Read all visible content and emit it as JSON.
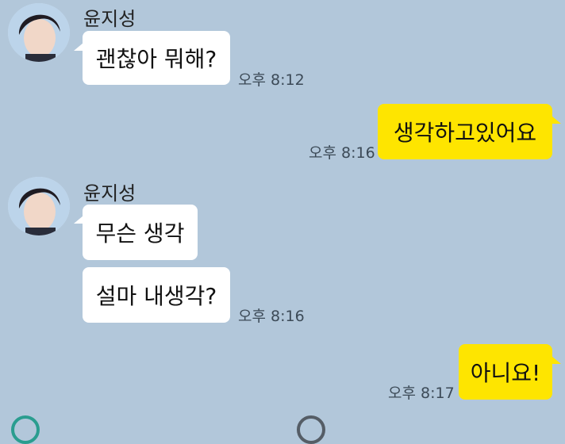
{
  "messages": [
    {
      "sender": "윤지성",
      "text": "괜찮아 뭐해?",
      "time": "오후 8:12"
    },
    {
      "text": "생각하고있어요",
      "time": "오후 8:16"
    },
    {
      "sender": "윤지성",
      "text": "무슨 생각"
    },
    {
      "text": "설마 내생각?",
      "time": "오후 8:16"
    },
    {
      "text": "아니요!",
      "time": "오후 8:17"
    }
  ],
  "colors": {
    "background": "#b2c7da",
    "incoming_bubble": "#ffffff",
    "outgoing_bubble": "#fee500"
  },
  "icons": [
    "avatar-photo",
    "avatar-photo",
    "emoji-button-icon",
    "more-button-icon"
  ]
}
